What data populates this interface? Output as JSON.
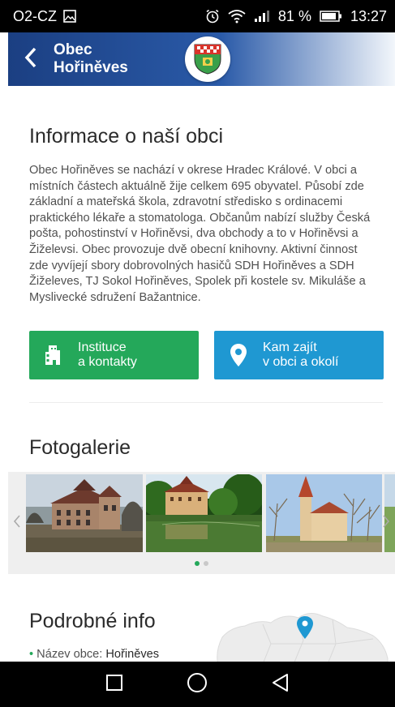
{
  "status_bar": {
    "carrier": "O2-CZ",
    "battery": "81 %",
    "time": "13:27",
    "icons": [
      "image-icon",
      "alarm-icon",
      "wifi-icon",
      "signal-icon",
      "battery-icon"
    ]
  },
  "app_bar": {
    "title_line1": "Obec",
    "title_line2": "Hořiněves",
    "back_icon": "chevron-left-icon",
    "emblem": "municipality-emblem"
  },
  "info": {
    "title": "Informace o naší obci",
    "text": "Obec Hořiněves se nachází v okrese Hradec Králové. V obci a místních částech aktuálně žije celkem 695 obyvatel. Působí zde základní a mateřská škola, zdravotní středisko s ordinacemi praktického lékaře a stomatologa. Občanům nabízí služby Česká pošta, pohostinství v Hořiněvsi, dva obchody a to v Hořiněvsi a Žiželevsi. Obec provozuje dvě obecní knihovny. Aktivní činnost zde vyvíjejí sbory dobrovolných hasičů SDH Hořiněves a SDH Žiželeves, TJ Sokol Hořiněves, Spolek při kostele sv. Mikuláše a Myslivecké sdružení Bažantnice."
  },
  "buttons": {
    "institutions_label": "Instituce\na kontakty",
    "places_label": "Kam zajít\nv obci a okolí",
    "colors": {
      "green": "#24a85a",
      "blue": "#1f98d2"
    }
  },
  "gallery": {
    "title": "Fotogalerie",
    "active_dot": 0,
    "dot_count": 2,
    "dot_colors": {
      "active": "#24a85a",
      "inactive": "#c9c9c9"
    }
  },
  "details": {
    "title": "Podrobné info",
    "name_label": "Název obce:",
    "name_value": "Hořiněves"
  },
  "nav_bar": {
    "icons": [
      "recent-apps-icon",
      "home-icon",
      "back-triangle-icon"
    ]
  }
}
